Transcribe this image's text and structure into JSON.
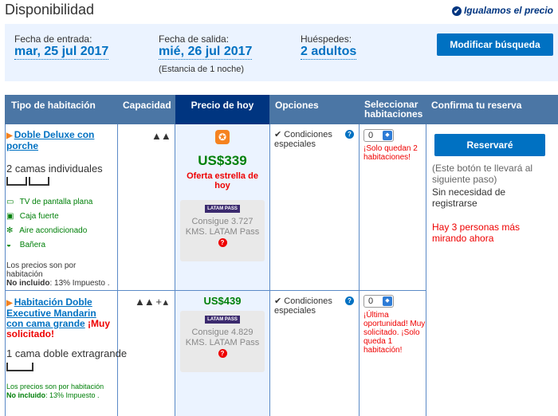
{
  "page": {
    "title": "Disponibilidad",
    "price_match": "Igualamos el precio"
  },
  "search": {
    "checkin_label": "Fecha de entrada:",
    "checkin_value": "mar, 25 jul 2017",
    "checkout_label": "Fecha de salida:",
    "checkout_value": "mié, 26 jul 2017",
    "stay_note": "(Estancia de 1 noche)",
    "guests_label": "Huéspedes:",
    "guests_value": "2 adultos",
    "modify_button": "Modificar búsqueda"
  },
  "table": {
    "headers": [
      "Tipo de habitación",
      "Capacidad",
      "Precio de hoy",
      "Opciones",
      "Seleccionar habitaciones",
      "Confirma tu reserva"
    ]
  },
  "rooms": [
    {
      "name": "Doble Deluxe con porche",
      "beds": "2 camas individuales",
      "amenities": [
        {
          "icon": "tv-icon",
          "label": "TV de pantalla plana"
        },
        {
          "icon": "safe-icon",
          "label": "Caja fuerte"
        },
        {
          "icon": "snowflake-icon",
          "label": "Aire acondicionado"
        },
        {
          "icon": "bathtub-icon",
          "label": "Bañera"
        }
      ],
      "price_note_1": "Los precios son por habitación",
      "price_note_bold": "No incluido",
      "price_note_2": ": 13% Impuesto .",
      "price": "US$339",
      "deal": "Oferta estrella de hoy",
      "latam_logo": "LATAM PASS",
      "latam_text": "Consigue 3.727 KMS. LATAM Pass",
      "condition": "Condiciones especiales",
      "select_value": "0",
      "availability": "¡Solo quedan 2 habitaciones!"
    },
    {
      "name": "Habitación Doble Executive Mandarin con cama grande",
      "tag": "¡Muy solicitado!",
      "beds": "1 cama doble extragrande",
      "price_note_1": "Los precios son por habitación",
      "price_note_bold": "No incluido",
      "price_note_2": ": 13% Impuesto .",
      "price": "US$439",
      "latam_logo": "LATAM PASS",
      "latam_text": "Consigue 4.829 KMS. LATAM Pass",
      "condition": "Condiciones especiales",
      "select_value": "0",
      "availability": "¡Última oportunidad! Muy solicitado. ¡Solo queda 1 habitación!"
    }
  ],
  "reserve": {
    "button": "Reservaré",
    "note": "(Este botón te llevará al siguiente paso)",
    "no_register": "Sin necesidad de registrarse",
    "viewers": "Hay 3 personas más mirando ahora"
  },
  "colors": {
    "header_bg": "#4b76a5",
    "price_header_bg": "#003580",
    "link": "#0071c2",
    "price_green": "#008009",
    "alert_red": "#e00000"
  }
}
